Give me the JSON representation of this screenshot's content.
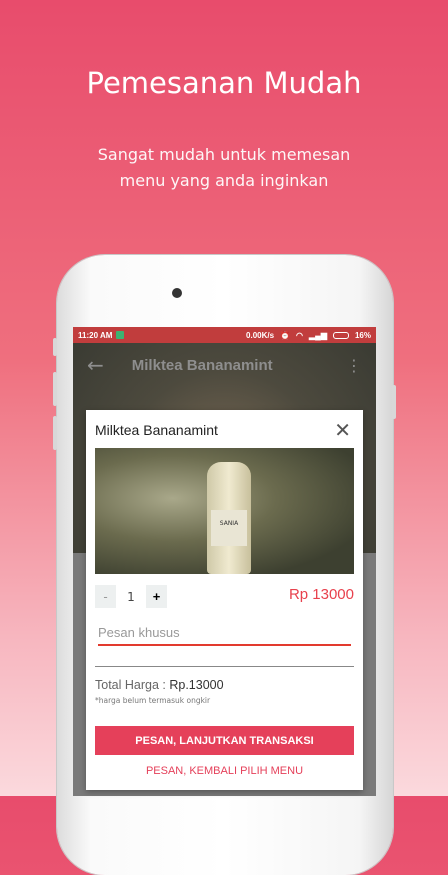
{
  "promo": {
    "title": "Pemesanan Mudah",
    "subtitle_line1": "Sangat mudah untuk memesan",
    "subtitle_line2": "menu yang anda inginkan"
  },
  "status_bar": {
    "time": "11:20 AM",
    "speed": "0.00K/s",
    "battery": "16%"
  },
  "app_bar": {
    "title": "Milktea Bananamint",
    "back_icon": "arrow-left-icon",
    "menu_icon": "more-vert-icon"
  },
  "dialog": {
    "title": "Milktea Bananamint",
    "bottle_label": "SANIA",
    "quantity": {
      "decrement": "-",
      "value": "1",
      "increment": "+"
    },
    "price": "Rp 13000",
    "note_placeholder": "Pesan khusus",
    "total_label": "Total Harga :",
    "total_value": "Rp.13000",
    "footnote": "*harga belum termasuk ongkir",
    "primary_button": "PESAN, LANJUTKAN TRANSAKSI",
    "secondary_button": "PESAN, KEMBALI PILIH MENU"
  },
  "colors": {
    "accent": "#e5405a",
    "status_bar": "#c13d3d",
    "price": "#e8414d"
  }
}
